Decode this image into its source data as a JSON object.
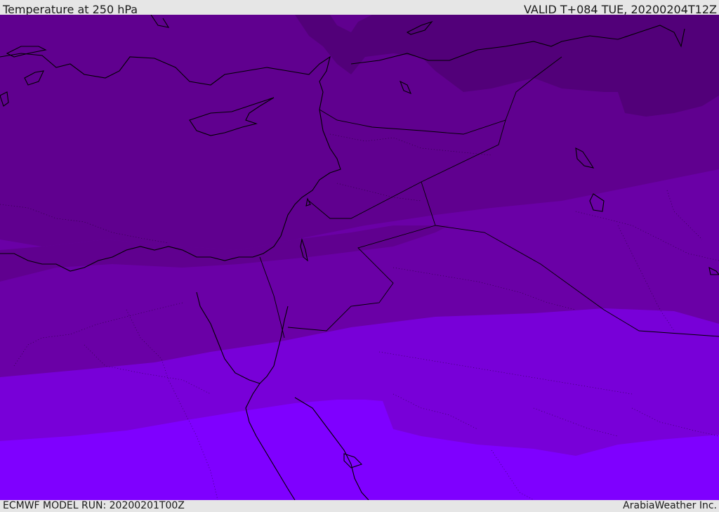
{
  "header": {
    "title": "Temperature at 250 hPa",
    "valid_time": "VALID T+084 TUE, 20200204T12Z"
  },
  "footer": {
    "model_run": "ECMWF MODEL RUN: 20200201T00Z",
    "credit": "ArabiaWeather Inc."
  },
  "map": {
    "variable": "Temperature",
    "level": "250 hPa",
    "region": "Eastern Mediterranean / Middle East",
    "colors": {
      "band_darkest": "#520079",
      "band_dark": "#60008f",
      "band_mid": "#6a00a6",
      "band_light": "#7800d8",
      "band_brightest": "#7f00ff",
      "coastline": "#000000",
      "border": "#000000"
    }
  }
}
